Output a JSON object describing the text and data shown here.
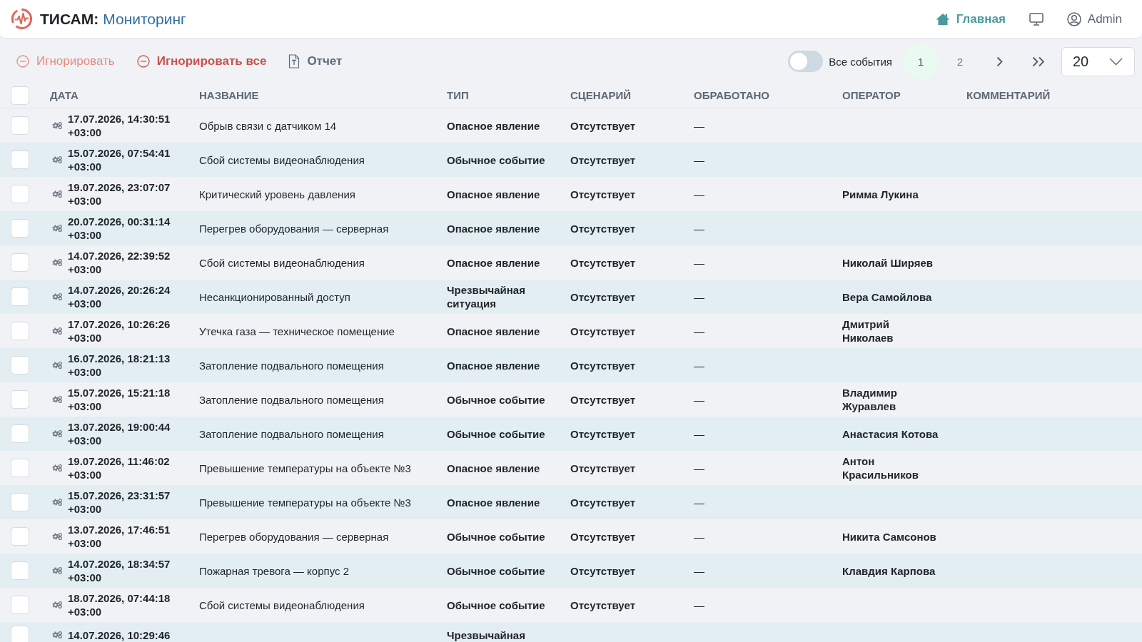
{
  "header": {
    "app_name": "ТИСАМ:",
    "section": "Мониторинг",
    "nav": [
      {
        "kind": "home",
        "label": "Главная",
        "selected": true
      },
      {
        "kind": "monitor",
        "selected": false
      },
      {
        "kind": "user",
        "label": "Admin",
        "selected": false
      }
    ]
  },
  "toolbar": {
    "actions": [
      {
        "kind": "ignore",
        "label": "Игнорировать",
        "disabled": true
      },
      {
        "kind": "ignore",
        "label": "Игнорировать все",
        "disabled": false
      },
      {
        "kind": "report",
        "label": "Отчет",
        "disabled": false
      }
    ],
    "toggle": {
      "label": "Все события",
      "on": false
    },
    "pagination": {
      "pages": [
        {
          "label": "1",
          "selected": true
        },
        {
          "label": "2",
          "selected": false
        }
      ]
    },
    "page_size": {
      "value": "20"
    }
  },
  "table": {
    "select_all": {
      "checked": false
    },
    "columns": [
      "ДАТА",
      "НАЗВАНИЕ",
      "ТИП",
      "СЦЕНАРИЙ",
      "ОБРАБОТАНО",
      "ОПЕРАТОР",
      "КОММЕНТАРИЙ"
    ],
    "rows": [
      {
        "checked": false,
        "date": "17.07.2026, 14:30:51 +03:00",
        "name": "Обрыв связи с датчиком 14",
        "type": "Опасное явление",
        "scenario": "Отсутствует",
        "processed": "—"
      },
      {
        "checked": false,
        "date": "15.07.2026, 07:54:41 +03:00",
        "name": "Сбой системы видеонаблюдения",
        "type": "Обычное событие",
        "scenario": "Отсутствует",
        "processed": "—"
      },
      {
        "checked": false,
        "date": "19.07.2026, 23:07:07 +03:00",
        "name": "Критический уровень давления",
        "type": "Опасное явление",
        "scenario": "Отсутствует",
        "processed": "—",
        "operator": "Римма Лукина"
      },
      {
        "checked": false,
        "date": "20.07.2026, 00:31:14 +03:00",
        "name": "Перегрев оборудования — серверная",
        "type": "Опасное явление",
        "scenario": "Отсутствует",
        "processed": "—"
      },
      {
        "checked": false,
        "date": "14.07.2026, 22:39:52 +03:00",
        "name": "Сбой системы видеонаблюдения",
        "type": "Опасное явление",
        "scenario": "Отсутствует",
        "processed": "—",
        "operator": "Николай Ширяев"
      },
      {
        "checked": false,
        "date": "14.07.2026, 20:26:24 +03:00",
        "name": "Несанкционированный доступ",
        "type": "Чрезвычайная ситуация",
        "scenario": "Отсутствует",
        "processed": "—",
        "operator": "Вера Самойлова"
      },
      {
        "checked": false,
        "date": "17.07.2026, 10:26:26 +03:00",
        "name": "Утечка газа — техническое помещение",
        "type": "Опасное явление",
        "scenario": "Отсутствует",
        "processed": "—",
        "operator": "Дмитрий Николаев"
      },
      {
        "checked": false,
        "date": "16.07.2026, 18:21:13 +03:00",
        "name": "Затопление подвального помещения",
        "type": "Опасное явление",
        "scenario": "Отсутствует",
        "processed": "—"
      },
      {
        "checked": false,
        "date": "15.07.2026, 15:21:18 +03:00",
        "name": "Затопление подвального помещения",
        "type": "Обычное событие",
        "scenario": "Отсутствует",
        "processed": "—",
        "operator": "Владимир Журавлев"
      },
      {
        "checked": false,
        "date": "13.07.2026, 19:00:44 +03:00",
        "name": "Затопление подвального помещения",
        "type": "Обычное событие",
        "scenario": "Отсутствует",
        "processed": "—",
        "operator": "Анастасия Котова"
      },
      {
        "checked": false,
        "date": "19.07.2026, 11:46:02 +03:00",
        "name": "Превышение температуры на объекте №3",
        "type": "Опасное явление",
        "scenario": "Отсутствует",
        "processed": "—",
        "operator": "Антон Красильников"
      },
      {
        "checked": false,
        "date": "15.07.2026, 23:31:57 +03:00",
        "name": "Превышение температуры на объекте №3",
        "type": "Опасное явление",
        "scenario": "Отсутствует",
        "processed": "—"
      },
      {
        "checked": false,
        "date": "13.07.2026, 17:46:51 +03:00",
        "name": "Перегрев оборудования — серверная",
        "type": "Обычное событие",
        "scenario": "Отсутствует",
        "processed": "—",
        "operator": "Никита Самсонов"
      },
      {
        "checked": false,
        "date": "14.07.2026, 18:34:57 +03:00",
        "name": "Пожарная тревога — корпус 2",
        "type": "Обычное событие",
        "scenario": "Отсутствует",
        "processed": "—",
        "operator": "Клавдия Карпова"
      },
      {
        "checked": false,
        "date": "18.07.2026, 07:44:18 +03:00",
        "name": "Сбой системы видеонаблюдения",
        "type": "Обычное событие",
        "scenario": "Отсутствует",
        "processed": "—"
      },
      {
        "checked": false,
        "date": "14.07.2026, 10:29:46",
        "type": "Чрезвычайная"
      }
    ]
  }
}
